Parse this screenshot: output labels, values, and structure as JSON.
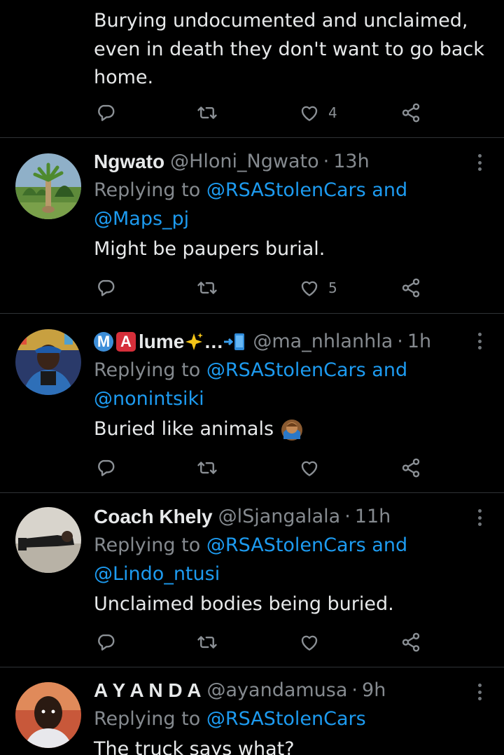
{
  "top_tweet": {
    "lines": [
      "Burying undocumented and unclaimed,",
      "even in death they don't want to go back",
      "home."
    ],
    "likes": "4"
  },
  "tweets": [
    {
      "name": "Ngwato",
      "handle": "@Hloni_Ngwato",
      "separator": "·",
      "time": "13h",
      "replying_prefix": "Replying to ",
      "mention1": "@RSAStolenCars",
      "joiner": " and",
      "mention2": "@Maps_pj",
      "text": "Might be paupers burial.",
      "likes": "5"
    },
    {
      "name": "lume",
      "name_badges": [
        "M",
        "A"
      ],
      "name_suffix": "…",
      "handle": "@ma_nhlanhla",
      "separator": "·",
      "time": "1h",
      "replying_prefix": "Replying to ",
      "mention1": "@RSAStolenCars",
      "joiner": " and",
      "mention2": "@nonintsiki",
      "text": "Buried like animals",
      "likes": ""
    },
    {
      "name": "Coach Khely",
      "handle": "@lSjangalala",
      "separator": "·",
      "time": "11h",
      "replying_prefix": "Replying to ",
      "mention1": "@RSAStolenCars",
      "joiner": " and",
      "mention2": "@Lindo_ntusi",
      "text": "Unclaimed bodies being buried.",
      "likes": ""
    },
    {
      "name": "A Y A N D A",
      "handle": "@ayandamusa",
      "separator": "·",
      "time": "9h",
      "replying_prefix": "Replying to ",
      "mention1": "@RSAStolenCars",
      "text": "The truck says what?"
    }
  ],
  "colors": {
    "background": "#000000",
    "text": "#e7e9ea",
    "muted": "#71767b",
    "link": "#1d9bf0",
    "divider": "#2f3336"
  }
}
